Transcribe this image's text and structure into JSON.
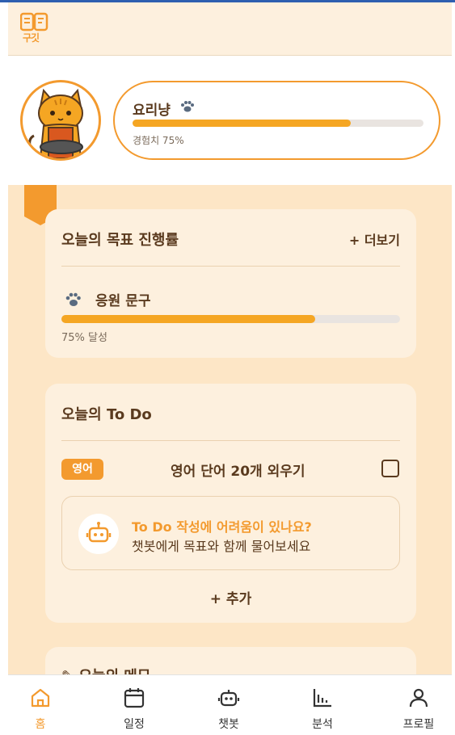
{
  "app": {
    "logo_text": "구깃"
  },
  "profile": {
    "level_name": "요리냥",
    "xp_label": "경험치 75%",
    "xp_percent": 75,
    "accent_color": "#f39a2e"
  },
  "goals_card": {
    "title": "오늘의 목표 진행률",
    "more_label": "+ 더보기",
    "goal": {
      "name": "응원 문구",
      "progress_percent": 75,
      "progress_label": "75% 달성"
    }
  },
  "todo_card": {
    "title": "오늘의 To Do",
    "items": [
      {
        "tag": "영어",
        "text": "영어 단어 20개 외우기",
        "checked": false
      }
    ],
    "help": {
      "title": "To Do 작성에 어려움이 있나요?",
      "subtitle": "챗봇에게 목표와 함께 물어보세요",
      "icon": "robot-icon"
    },
    "add_label": "+ 추가"
  },
  "memo_card": {
    "title": "✎ 오늘의 메모"
  },
  "navbar": {
    "items": [
      {
        "label": "홈",
        "icon": "home-icon",
        "active": true
      },
      {
        "label": "일정",
        "icon": "calendar-icon",
        "active": false
      },
      {
        "label": "챗봇",
        "icon": "robot-icon",
        "active": false
      },
      {
        "label": "분석",
        "icon": "chart-icon",
        "active": false
      },
      {
        "label": "프로필",
        "icon": "user-icon",
        "active": false
      }
    ]
  }
}
